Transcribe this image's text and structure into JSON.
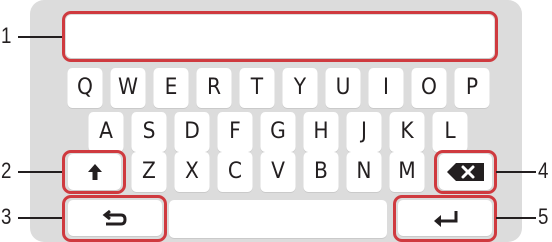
{
  "keyboard": {
    "text_field_value": "",
    "row1": [
      "Q",
      "W",
      "E",
      "R",
      "T",
      "Y",
      "U",
      "I",
      "O",
      "P"
    ],
    "row2": [
      "A",
      "S",
      "D",
      "F",
      "G",
      "H",
      "J",
      "K",
      "L"
    ],
    "row3": [
      "Z",
      "X",
      "C",
      "V",
      "B",
      "N",
      "M"
    ],
    "shift_icon": "arrow-up-icon",
    "backspace_icon": "backspace-x-icon",
    "back_icon": "return-back-arrow-icon",
    "enter_icon": "enter-icon",
    "space_label": ""
  },
  "callouts": [
    "1",
    "2",
    "3",
    "4",
    "5"
  ],
  "colors": {
    "panel": "#dcdcdc",
    "key": "#ffffff",
    "highlight": "#cf3a3f",
    "text": "#231f20"
  }
}
